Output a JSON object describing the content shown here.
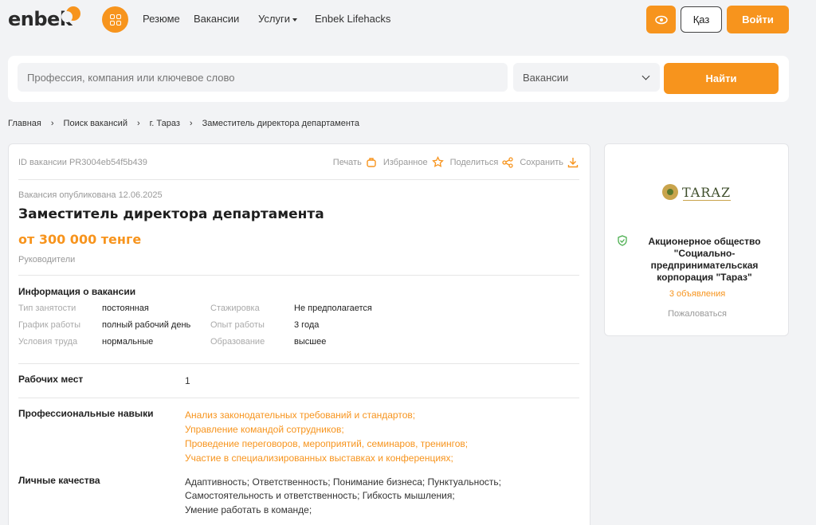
{
  "header": {
    "logo": "enbek",
    "nav": [
      "Резюме",
      "Вакансии",
      "Услуги",
      "Enbek Lifehacks"
    ],
    "lang": "Қаз",
    "login": "Войти"
  },
  "search": {
    "placeholder": "Профессия, компания или ключевое слово",
    "type": "Вакансии",
    "button": "Найти"
  },
  "breadcrumb": [
    "Главная",
    "Поиск вакансий",
    "г. Тараз",
    "Заместитель директора департамента"
  ],
  "vacancy": {
    "id": "ID вакансии PR3004eb54f5b439",
    "actions": [
      "Печать",
      "Избранное",
      "Поделиться",
      "Сохранить"
    ],
    "published": "Вакансия опубликована 12.06.2025",
    "title": "Заместитель директора департамента",
    "salary": "от 300 000 тенге",
    "category": "Руководители",
    "info_title": "Информация о вакансии",
    "info": [
      {
        "label": "Тип занятости",
        "value": "постоянная"
      },
      {
        "label": "График работы",
        "value": "полный рабочий день"
      },
      {
        "label": "Условия труда",
        "value": "нормальные"
      },
      {
        "label": "Стажировка",
        "value": "Не предполагается"
      },
      {
        "label": "Опыт работы",
        "value": "3 года"
      },
      {
        "label": "Образование",
        "value": "высшее"
      }
    ],
    "workplaces_label": "Рабочих мест",
    "workplaces": "1",
    "skills_label": "Профессиональные навыки",
    "skills": [
      "Анализ законодательных требований и стандартов;",
      "Управление командой сотрудников;",
      "Проведение переговоров, мероприятий, семинаров, тренингов;",
      "Участие в специализированных выставках и конференциях;"
    ],
    "qualities_label": "Личные качества",
    "qualities": [
      "Адаптивность; Ответственность; Понимание бизнеса; Пунктуальность;",
      "Самостоятельность и ответственность; Гибкость мышления;",
      "Умение работать в команде;"
    ]
  },
  "company": {
    "logo_text": "TARAZ",
    "name": "Акционерное общество \"Социально-предпринимательская корпорация \"Тараз\"",
    "count": "3 объявления",
    "complain": "Пожаловаться"
  },
  "colors": {
    "accent": "#f7941d",
    "background": "#f2f3f5"
  }
}
